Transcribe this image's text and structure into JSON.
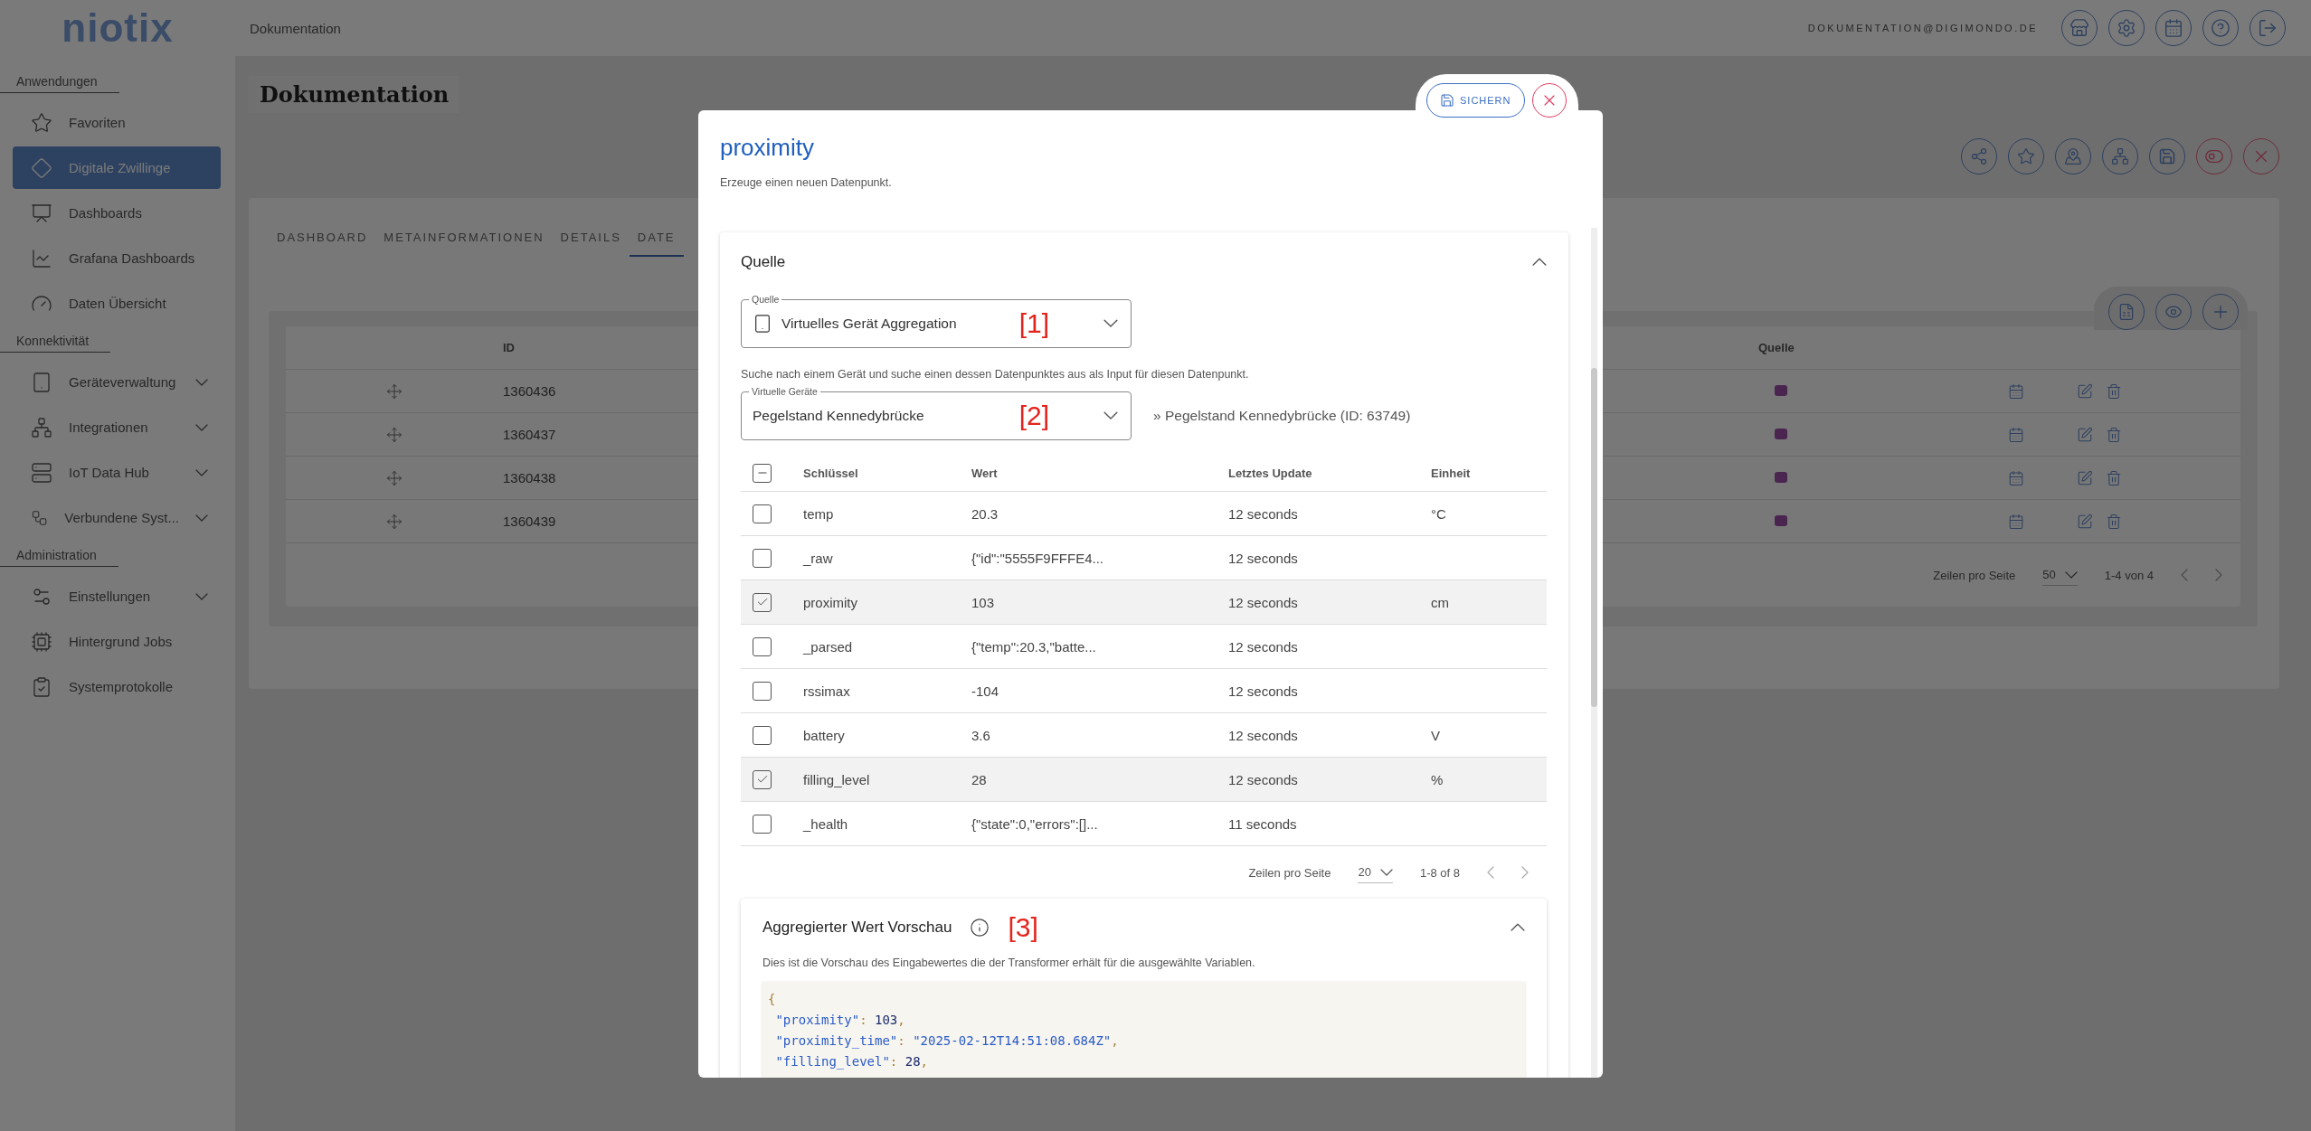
{
  "brand": {
    "logo": "niotix"
  },
  "header": {
    "breadcrumb": "Dokumentation",
    "user_email": "DOKUMENTATION@DIGIMONDO.DE"
  },
  "sidebar": {
    "sections": [
      {
        "title": "Anwendungen",
        "items": [
          {
            "label": "Favoriten",
            "selected": false,
            "has_submenu": false
          },
          {
            "label": "Digitale Zwillinge",
            "selected": true,
            "has_submenu": false
          },
          {
            "label": "Dashboards",
            "selected": false,
            "has_submenu": false
          },
          {
            "label": "Grafana Dashboards",
            "selected": false,
            "has_submenu": false
          },
          {
            "label": "Daten Übersicht",
            "selected": false,
            "has_submenu": false
          }
        ]
      },
      {
        "title": "Konnektivität",
        "items": [
          {
            "label": "Geräteverwaltung",
            "selected": false,
            "has_submenu": true
          },
          {
            "label": "Integrationen",
            "selected": false,
            "has_submenu": true
          },
          {
            "label": "IoT Data Hub",
            "selected": false,
            "has_submenu": true
          },
          {
            "label": "Verbundene Syst...",
            "selected": false,
            "has_submenu": true
          }
        ]
      },
      {
        "title": "Administration",
        "items": [
          {
            "label": "Einstellungen",
            "selected": false,
            "has_submenu": true
          },
          {
            "label": "Hintergrund Jobs",
            "selected": false,
            "has_submenu": false
          },
          {
            "label": "Systemprotokolle",
            "selected": false,
            "has_submenu": false
          }
        ]
      }
    ]
  },
  "page": {
    "title": "Dokumentation",
    "tabs": [
      {
        "label": "DASHBOARD",
        "selected": false
      },
      {
        "label": "METAINFORMATIONEN",
        "selected": false
      },
      {
        "label": "DETAILS",
        "selected": false
      },
      {
        "label": "DATE",
        "selected": true
      }
    ],
    "table": {
      "columns": [
        "ID",
        "Quelle"
      ],
      "rows": [
        {
          "id": "1360436"
        },
        {
          "id": "1360437"
        },
        {
          "id": "1360438"
        },
        {
          "id": "1360439"
        }
      ]
    },
    "pagination": {
      "rows_per_page_label": "Zeilen pro Seite",
      "rows_per_page": "50",
      "range": "1-4 von 4"
    }
  },
  "modal": {
    "title": "proximity",
    "subtitle": "Erzeuge einen neuen Datenpunkt.",
    "save_label": "SICHERN",
    "source": {
      "title": "Quelle",
      "expanded": true,
      "source_select": {
        "label": "Quelle",
        "value": "Virtuelles Gerät Aggregation",
        "annotation": "[1]"
      },
      "hint": "Suche nach einem Gerät und suche einen dessen Datenpunktes aus als Input für diesen Datenpunkt.",
      "device_select": {
        "label": "Virtuelle Geräte",
        "value": "Pegelstand Kennedybrücke",
        "annotation": "[2]"
      },
      "device_info": "» Pegelstand Kennedybrücke (ID: 63749)",
      "table": {
        "select_all": {
          "indeterminate": true
        },
        "columns": [
          "Schlüssel",
          "Wert",
          "Letztes Update",
          "Einheit"
        ],
        "rows": [
          {
            "key": "temp",
            "value": "20.3",
            "updated": "12 seconds",
            "unit": "°C",
            "checked": false
          },
          {
            "key": "_raw",
            "value": "{\"id\":\"5555F9FFFE4...",
            "updated": "12 seconds",
            "checked": false
          },
          {
            "key": "proximity",
            "value": "103",
            "updated": "12 seconds",
            "unit": "cm",
            "checked": true
          },
          {
            "key": "_parsed",
            "value": "{\"temp\":20.3,\"batte...",
            "updated": "12 seconds",
            "checked": false
          },
          {
            "key": "rssimax",
            "value": "-104",
            "updated": "12 seconds",
            "checked": false
          },
          {
            "key": "battery",
            "value": "3.6",
            "updated": "12 seconds",
            "unit": "V",
            "checked": false
          },
          {
            "key": "filling_level",
            "value": "28",
            "updated": "12 seconds",
            "unit": "%",
            "checked": true
          },
          {
            "key": "_health",
            "value": "{\"state\":0,\"errors\":[]...",
            "updated": "11 seconds",
            "checked": false
          }
        ]
      },
      "pagination": {
        "rows_per_page_label": "Zeilen pro Seite",
        "rows_per_page": "20",
        "range": "1-8 of 8"
      }
    },
    "preview": {
      "title": "Aggregierter Wert Vorschau",
      "annotation": "[3]",
      "expanded": true,
      "description": "Dies ist die Vorschau des Eingabewertes die der Transformer erhält für die ausgewählte Variablen.",
      "code_lines": [
        [
          {
            "kind": "punct",
            "text": "{"
          }
        ],
        [
          {
            "kind": "key",
            "text": " \"proximity\""
          },
          {
            "kind": "punct",
            "text": ": "
          },
          {
            "kind": "num",
            "text": "103"
          },
          {
            "kind": "punct",
            "text": ","
          }
        ],
        [
          {
            "kind": "key",
            "text": " \"proximity_time\""
          },
          {
            "kind": "punct",
            "text": ": "
          },
          {
            "kind": "str",
            "text": "\"2025-02-12T14:51:08.684Z\""
          },
          {
            "kind": "punct",
            "text": ","
          }
        ],
        [
          {
            "kind": "key",
            "text": " \"filling_level\""
          },
          {
            "kind": "punct",
            "text": ": "
          },
          {
            "kind": "num",
            "text": "28"
          },
          {
            "kind": "punct",
            "text": ","
          }
        ]
      ]
    }
  }
}
